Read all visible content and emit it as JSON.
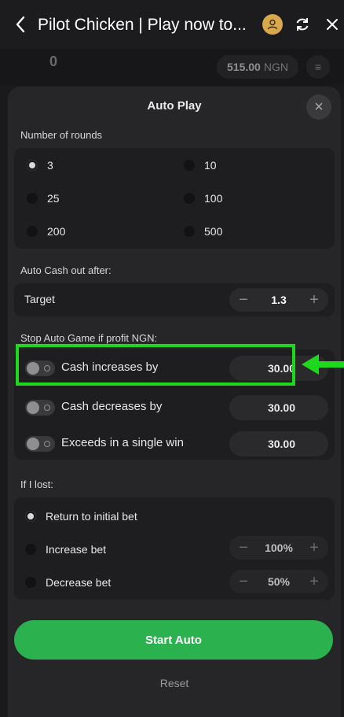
{
  "topbar": {
    "title": "Pilot Chicken | Play now to...",
    "icons": [
      "back-arrow-icon",
      "user-icon",
      "refresh-icon",
      "close-icon"
    ]
  },
  "gamebar": {
    "logo": "0",
    "balance_amount": "515.00",
    "balance_currency": "NGN"
  },
  "modal": {
    "title": "Auto Play",
    "rounds": {
      "label": "Number of rounds",
      "options": [
        {
          "label": "3",
          "selected": true
        },
        {
          "label": "10",
          "selected": false
        },
        {
          "label": "25",
          "selected": false
        },
        {
          "label": "100",
          "selected": false
        },
        {
          "label": "200",
          "selected": false
        },
        {
          "label": "500",
          "selected": false
        }
      ]
    },
    "cashout": {
      "label": "Auto Cash out after:",
      "target_label": "Target",
      "target_value": "1.3"
    },
    "stop": {
      "label": "Stop Auto Game if profit NGN:",
      "rows": [
        {
          "label": "Cash increases by",
          "value": "30.00",
          "enabled": false
        },
        {
          "label": "Cash decreases by",
          "value": "30.00",
          "enabled": false
        },
        {
          "label": "Exceeds in a single win",
          "value": "30.00",
          "enabled": false
        }
      ]
    },
    "lost": {
      "label": "If I lost:",
      "options": [
        {
          "label": "Return to initial bet",
          "selected": true
        },
        {
          "label": "Increase bet",
          "value": "100%",
          "selected": false
        },
        {
          "label": "Decrease bet",
          "value": "50%",
          "selected": false
        }
      ]
    },
    "start_label": "Start Auto",
    "reset_label": "Reset"
  },
  "colors": {
    "accent_green": "#2bb14e",
    "highlight_green": "#1ed81e",
    "panel": "#1e1e20",
    "modal": "#262628"
  }
}
